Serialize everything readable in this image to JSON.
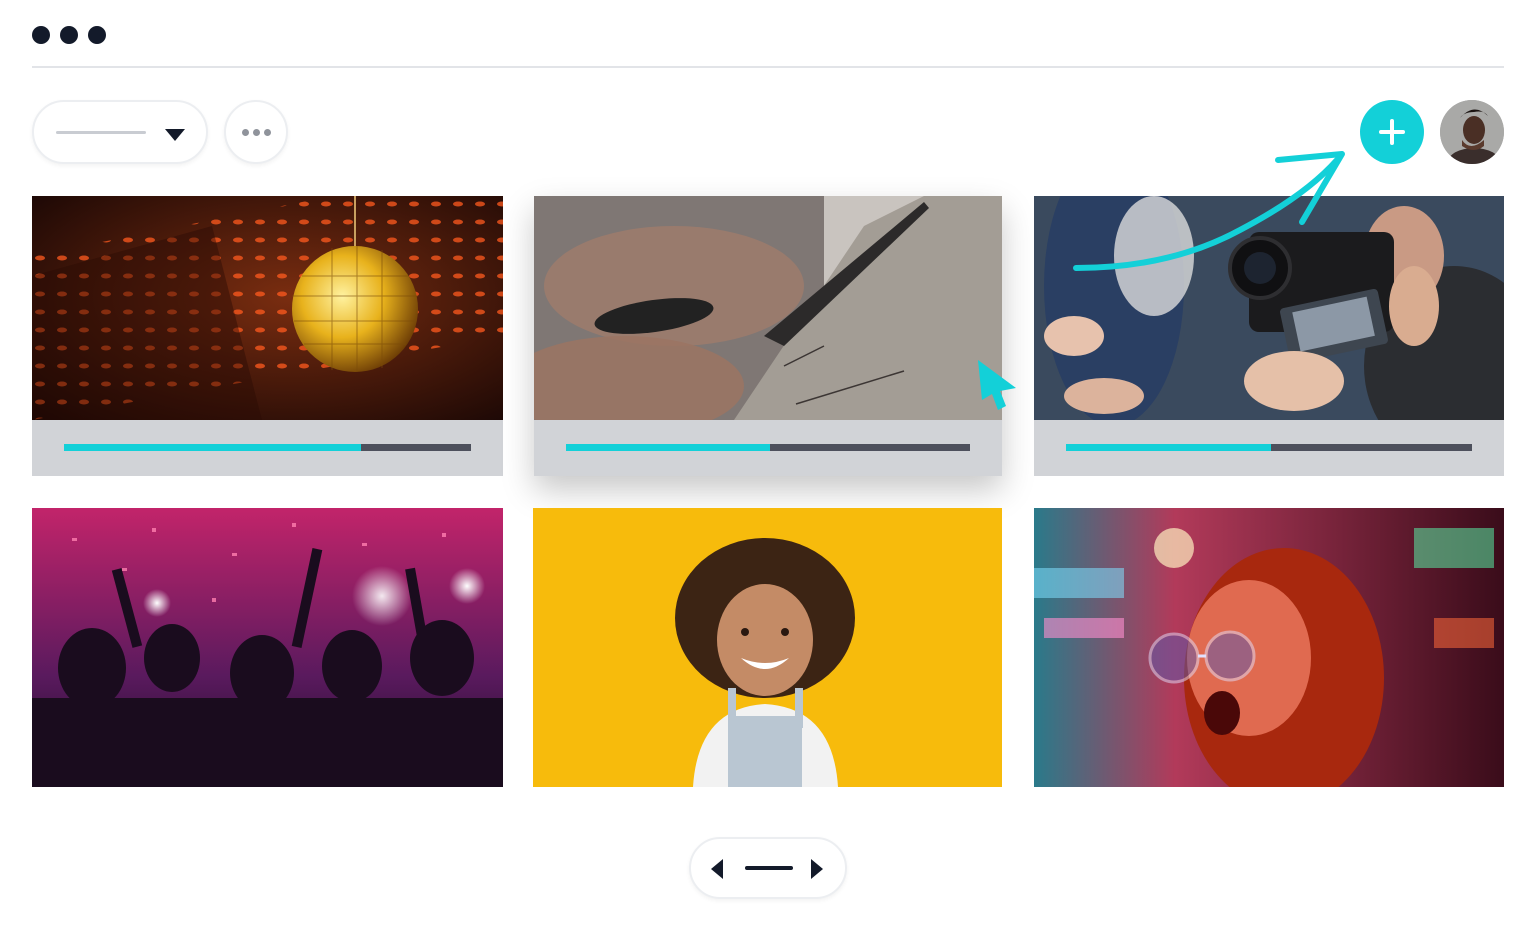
{
  "window": {
    "controls": [
      "dot",
      "dot",
      "dot"
    ]
  },
  "toolbar": {
    "dropdown": {
      "selected_value": "",
      "icon": "caret-down-icon"
    },
    "more_icon": "more-horizontal-icon",
    "add_icon": "plus-icon",
    "avatar_icon": "user-avatar"
  },
  "gallery": {
    "cards": [
      {
        "photo": "disco-ball",
        "progress": 0.73
      },
      {
        "photo": "scissors-cutting-paper",
        "progress": 0.505
      },
      {
        "photo": "camera-recording",
        "progress": 0.505
      },
      {
        "photo": "party-crowd"
      },
      {
        "photo": "smiling-girl-yellow"
      },
      {
        "photo": "woman-neon-lights"
      }
    ]
  },
  "annotations": {
    "cursor_icon": "pointer-arrow-icon",
    "arrow_icon": "curved-arrow-icon"
  },
  "pager": {
    "prev_icon": "triangle-left-icon",
    "next_icon": "triangle-right-icon"
  },
  "colors": {
    "accent": "#13d0d8",
    "dark": "#131a2a",
    "track": "#4d505c",
    "footer": "#d1d3d7"
  }
}
